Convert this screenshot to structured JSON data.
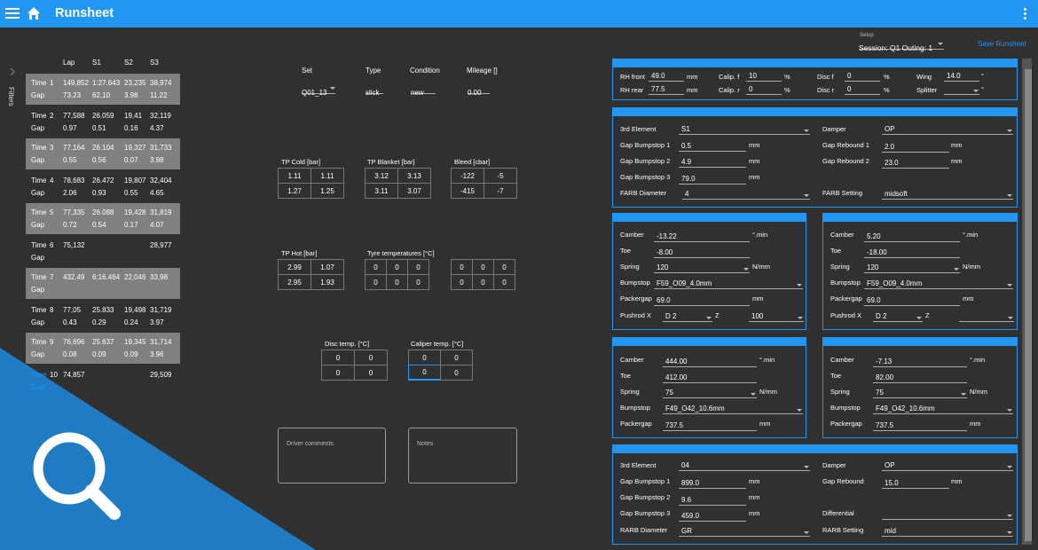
{
  "app": {
    "title": "Runsheet"
  },
  "filters_label": "Filters",
  "setup": {
    "label": "Setup",
    "session": "Session: Q1 Outing: 1",
    "save": "Save Runsheet"
  },
  "laps": {
    "headers": [
      "Lap",
      "S1",
      "S2",
      "S3"
    ],
    "rows": [
      {
        "n": "1",
        "time": [
          "149,852",
          "1:27.643",
          "23,235",
          "38,974"
        ],
        "gap": [
          "73.23",
          "62.10",
          "3.98",
          "11.22"
        ]
      },
      {
        "n": "2",
        "time": [
          "77,588",
          "26.059",
          "19,41",
          "32,119"
        ],
        "gap": [
          "0.97",
          "0.51",
          "0.16",
          "4.37"
        ]
      },
      {
        "n": "3",
        "time": [
          "77,164",
          "26.104",
          "19,327",
          "31,733"
        ],
        "gap": [
          "0.55",
          "0.56",
          "0.07",
          "3.98"
        ]
      },
      {
        "n": "4",
        "time": [
          "78,683",
          "26.472",
          "19,807",
          "32,404"
        ],
        "gap": [
          "2.06",
          "0.93",
          "0.55",
          "4.65"
        ]
      },
      {
        "n": "5",
        "time": [
          "77,335",
          "26.088",
          "19,428",
          "31,819"
        ],
        "gap": [
          "0.72",
          "0.54",
          "0.17",
          "4.07"
        ]
      },
      {
        "n": "6",
        "time": [
          "75,132",
          "",
          "",
          "28,977"
        ],
        "gap": [
          "",
          "",
          "",
          ""
        ]
      },
      {
        "n": "7",
        "time": [
          "432,49",
          "6:16.464",
          "22,046",
          "33,98"
        ],
        "gap": [
          "",
          "",
          "",
          ""
        ]
      },
      {
        "n": "8",
        "time": [
          "77,05",
          "25.833",
          "19,498",
          "31,719"
        ],
        "gap": [
          "0.43",
          "0.29",
          "0.24",
          "3.97"
        ]
      },
      {
        "n": "9",
        "time": [
          "76,696",
          "25.637",
          "19,345",
          "31,714"
        ],
        "gap": [
          "0.08",
          "0.09",
          "0.09",
          "3.96"
        ]
      },
      {
        "n": "10",
        "time": [
          "74,857",
          "",
          "",
          "29,509"
        ],
        "gap": [
          "",
          "",
          "",
          ""
        ]
      }
    ],
    "time_label": "Time",
    "gap_label": "Gap"
  },
  "tyres": {
    "set_label": "Set",
    "set_value": "Q01_13",
    "type_label": "Type",
    "type_value": "slick",
    "condition_label": "Condition",
    "condition_value": "new",
    "mileage_label": "Mileage []",
    "mileage_value": "0.00",
    "tp_cold": {
      "label": "TP Cold [bar]",
      "values": [
        "1.11",
        "1.11",
        "1.27",
        "1.25"
      ]
    },
    "tp_blanket": {
      "label": "TP Blanket [bar]",
      "values": [
        "3.12",
        "3.13",
        "3.11",
        "3.07"
      ]
    },
    "bleed": {
      "label": "Bleed [cbar]",
      "values": [
        "-122",
        "-5",
        "-415",
        "-7"
      ]
    },
    "tp_hot": {
      "label": "TP Hot [bar]",
      "values": [
        "2.99",
        "1.07",
        "2.95",
        "1.93"
      ]
    },
    "tyre_temps": {
      "label": "Tyre temperatures [°C]",
      "left": [
        "0",
        "0",
        "0",
        "0",
        "0",
        "0"
      ],
      "right": [
        "0",
        "0",
        "0",
        "0",
        "0",
        "0"
      ]
    },
    "disc_temp": {
      "label": "Disc temp. [°C]",
      "values": [
        "0",
        "0",
        "0",
        "0"
      ]
    },
    "caliper_temp": {
      "label": "Caliper temp. [°C]",
      "values": [
        "0",
        "0",
        "0",
        "0"
      ]
    },
    "driver_comments": "Driver comments",
    "notes": "Notes"
  },
  "aero": {
    "rh_front_label": "RH front",
    "rh_front": "49.0",
    "rh_rear_label": "RH rear",
    "rh_rear": "77.5",
    "mm": "mm",
    "calip_f_label": "Calip. f",
    "calip_f": "10",
    "calip_r_label": "Calip. r",
    "calip_r": "0",
    "pct": "%",
    "disc_f_label": "Disc f",
    "disc_f": "0",
    "disc_r_label": "Disc r",
    "disc_r": "0",
    "wing_label": "Wing",
    "wing": "14.0",
    "splitter_label": "Splitter",
    "splitter": "",
    "deg": "°"
  },
  "front": {
    "third_element_label": "3rd Element",
    "third_element": "S1",
    "gap_bs1_label": "Gap Bumpstop 1",
    "gap_bs1": "0.5",
    "gap_bs2_label": "Gap Bumpstop 2",
    "gap_bs2": "4.9",
    "gap_bs3_label": "Gap Bumpstop 3",
    "gap_bs3": "79.0",
    "farb_diameter_label": "FARB Diameter",
    "farb_diameter": "4",
    "damper_label": "Damper",
    "damper": "OP",
    "gap_rebound1_label": "Gap Rebound 1",
    "gap_rebound1": "2.0",
    "gap_rebound2_label": "Gap Rebound 2",
    "gap_rebound2": "23.0",
    "farb_setting_label": "FARB Setting",
    "farb_setting": "midsoft"
  },
  "fl": {
    "camber": "-13.22",
    "toe": "-8.00",
    "spring": "120",
    "bumpstop": "F59_O09_4.0mm",
    "packergap": "69.0",
    "pushrod": "D 2",
    "z": "100"
  },
  "fr": {
    "camber": "5.20",
    "toe": "-18.00",
    "spring": "120",
    "bumpstop": "F59_O09_4.0mm",
    "packergap": "69.0",
    "pushrod": "D 2",
    "z": ""
  },
  "rl": {
    "camber": "444.00",
    "toe": "412.00",
    "spring": "75",
    "bumpstop": "F49_O42_10.6mm",
    "packergap": "737.5"
  },
  "rr": {
    "camber": "-7.13",
    "toe": "82.00",
    "spring": "75",
    "bumpstop": "F49_O42_10.6mm",
    "packergap": "737.5"
  },
  "corner_labels": {
    "camber": "Camber",
    "toe": "Toe",
    "spring": "Spring",
    "bumpstop": "Bumpstop",
    "packergap": "Packergap",
    "pushrod": "Pushrod X",
    "z": "Z",
    "min": "°.min",
    "nmm": "N/mm",
    "mm": "mm"
  },
  "rear": {
    "third_element_label": "3rd Element",
    "third_element": "04",
    "gap_bs1_label": "Gap Bumpstop 1",
    "gap_bs1": "899.0",
    "gap_bs2_label": "Gap Bumpstop 2",
    "gap_bs2": "9.6",
    "gap_bs3_label": "Gap Bumpstop 3",
    "gap_bs3": "459.0",
    "rarb_diameter_label": "RARB Diameter",
    "rarb_diameter": "GR",
    "damper_label": "Damper",
    "damper": "OP",
    "gap_rebound_label": "Gap Rebound",
    "gap_rebound": "15.0",
    "differential_label": "Differential",
    "differential": "",
    "rarb_setting_label": "RARB Setting",
    "rarb_setting": "mid"
  },
  "colors": {
    "accent": "#2196f3",
    "background": "#303030",
    "row_shade": "#808080"
  }
}
